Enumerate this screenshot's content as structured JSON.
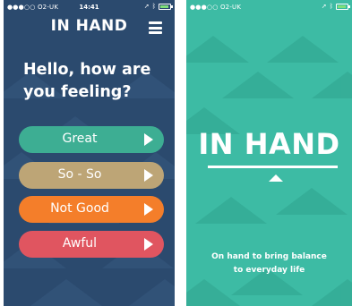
{
  "left_screen": {
    "status_bar": {
      "carrier": "●●●○○ O2-UK",
      "time": "14:41"
    },
    "header": {
      "title": "IN HAND",
      "menu_icon": "hamburger-menu-icon"
    },
    "greeting": "Hello, how are you feeling?",
    "mood_options": [
      {
        "label": "Great",
        "color": "#3dae93"
      },
      {
        "label": "So - So",
        "color": "#bda576"
      },
      {
        "label": "Not Good",
        "color": "#f47e2a"
      },
      {
        "label": "Awful",
        "color": "#e05560"
      }
    ],
    "background_color": "#2b4a6e"
  },
  "right_screen": {
    "status_bar": {
      "carrier": "●●●○○ O2-UK"
    },
    "logo_text": "IN HAND",
    "tagline_line1": "On hand to bring balance",
    "tagline_line2": "to everyday life",
    "background_color": "#3dbba4"
  }
}
